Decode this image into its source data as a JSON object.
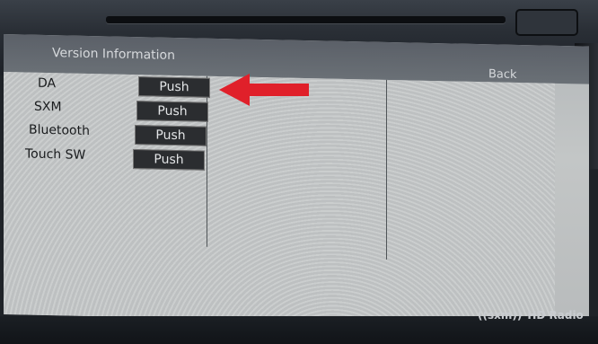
{
  "screen": {
    "title": "Version Information",
    "back_label": "Back"
  },
  "rows": [
    {
      "label": "DA",
      "button": "Push"
    },
    {
      "label": "SXM",
      "button": "Push"
    },
    {
      "label": "Bluetooth",
      "button": "Push"
    },
    {
      "label": "Touch SW",
      "button": "Push"
    }
  ],
  "branding": {
    "sxm": "((sxm))",
    "hd": "HD Radio"
  },
  "colors": {
    "arrow": "#e0202a",
    "button_bg": "#2b2d30",
    "screen_bg": "#c5c8c9"
  },
  "icons": {
    "annotation": "red-arrow-icon",
    "eject": "eject-button-icon"
  }
}
